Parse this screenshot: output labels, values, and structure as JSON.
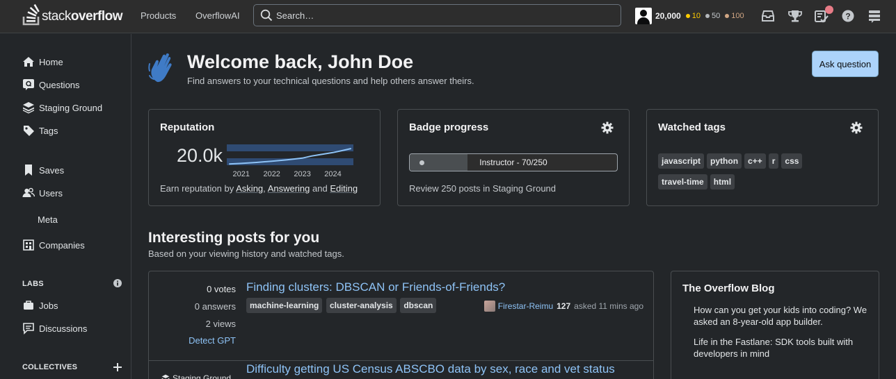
{
  "header": {
    "logo_regular": "stack",
    "logo_bold": "overflow",
    "nav": [
      "Products",
      "OverflowAI"
    ],
    "search_placeholder": "Search…",
    "reputation": "20,000",
    "badges": {
      "gold": "10",
      "silver": "50",
      "bronze": "100"
    },
    "icons": [
      "inbox-icon",
      "achievements-icon",
      "review-queue-icon",
      "help-icon",
      "site-switcher-icon"
    ]
  },
  "sidebar": {
    "items": [
      {
        "label": "Home",
        "icon": "home-icon"
      },
      {
        "label": "Questions",
        "icon": "questions-icon"
      },
      {
        "label": "Staging Ground",
        "icon": "staging-ground-icon"
      },
      {
        "label": "Tags",
        "icon": "tag-icon"
      },
      {
        "label": "Saves",
        "icon": "bookmark-icon"
      },
      {
        "label": "Users",
        "icon": "users-icon"
      },
      {
        "label": "Meta",
        "icon": ""
      },
      {
        "label": "Companies",
        "icon": "companies-icon"
      }
    ],
    "labs_heading": "LABS",
    "labs_items": [
      {
        "label": "Jobs",
        "icon": "briefcase-icon"
      },
      {
        "label": "Discussions",
        "icon": "discussions-icon"
      }
    ],
    "collectives_heading": "COLLECTIVES"
  },
  "welcome": {
    "title": "Welcome back, John Doe",
    "subtitle": "Find answers to your technical questions and help others answer theirs.",
    "ask_button": "Ask question"
  },
  "reputation_card": {
    "title": "Reputation",
    "value": "20.0k",
    "foot_prefix": "Earn reputation by ",
    "foot_link1": "Asking",
    "foot_sep1": ", ",
    "foot_link2": "Answering",
    "foot_sep2": " and ",
    "foot_link3": "Editing"
  },
  "chart_data": {
    "type": "line",
    "title": "",
    "xlabel": "",
    "ylabel": "",
    "categories": [
      "2021",
      "2022",
      "2023",
      "2024"
    ],
    "x": [
      2020.6,
      2021.0,
      2021.5,
      2022.0,
      2022.5,
      2023.0,
      2023.3,
      2023.6,
      2024.0,
      2024.3,
      2024.6
    ],
    "series": [
      {
        "values": [
          1500,
          2200,
          3300,
          4800,
          6500,
          8500,
          11000,
          12800,
          15200,
          17500,
          20000
        ]
      }
    ],
    "ylim": [
      0,
      25000
    ],
    "grid": true
  },
  "badge_card": {
    "title": "Badge progress",
    "progress_label": "Instructor - 70/250",
    "progress_fraction": 0.28,
    "foot": "Review 250 posts in Staging Ground"
  },
  "tags_card": {
    "title": "Watched tags",
    "tags": [
      "javascript",
      "python",
      "c++",
      "r",
      "css",
      "travel-time",
      "html"
    ]
  },
  "interesting": {
    "title": "Interesting posts for you",
    "subtitle": "Based on your viewing history and watched tags."
  },
  "posts": [
    {
      "votes": "0 votes",
      "answers": "0 answers",
      "views": "2 views",
      "extra": "Detect GPT",
      "title": "Finding clusters: DBSCAN or Friends-of-Friends?",
      "tags": [
        "machine-learning",
        "cluster-analysis",
        "dbscan"
      ],
      "user": "Firestar-Reimu",
      "user_rep": "127",
      "time": "asked 11 mins ago"
    },
    {
      "label": "Staging Ground",
      "title": "Difficulty getting US Census ABSCBO data by sex, race and vet status"
    }
  ],
  "blog": {
    "title": "The Overflow Blog",
    "items": [
      "How can you get your kids into coding? We asked an 8-year-old app builder.",
      "Life in the Fastlane: SDK tools built with developers in mind"
    ]
  }
}
